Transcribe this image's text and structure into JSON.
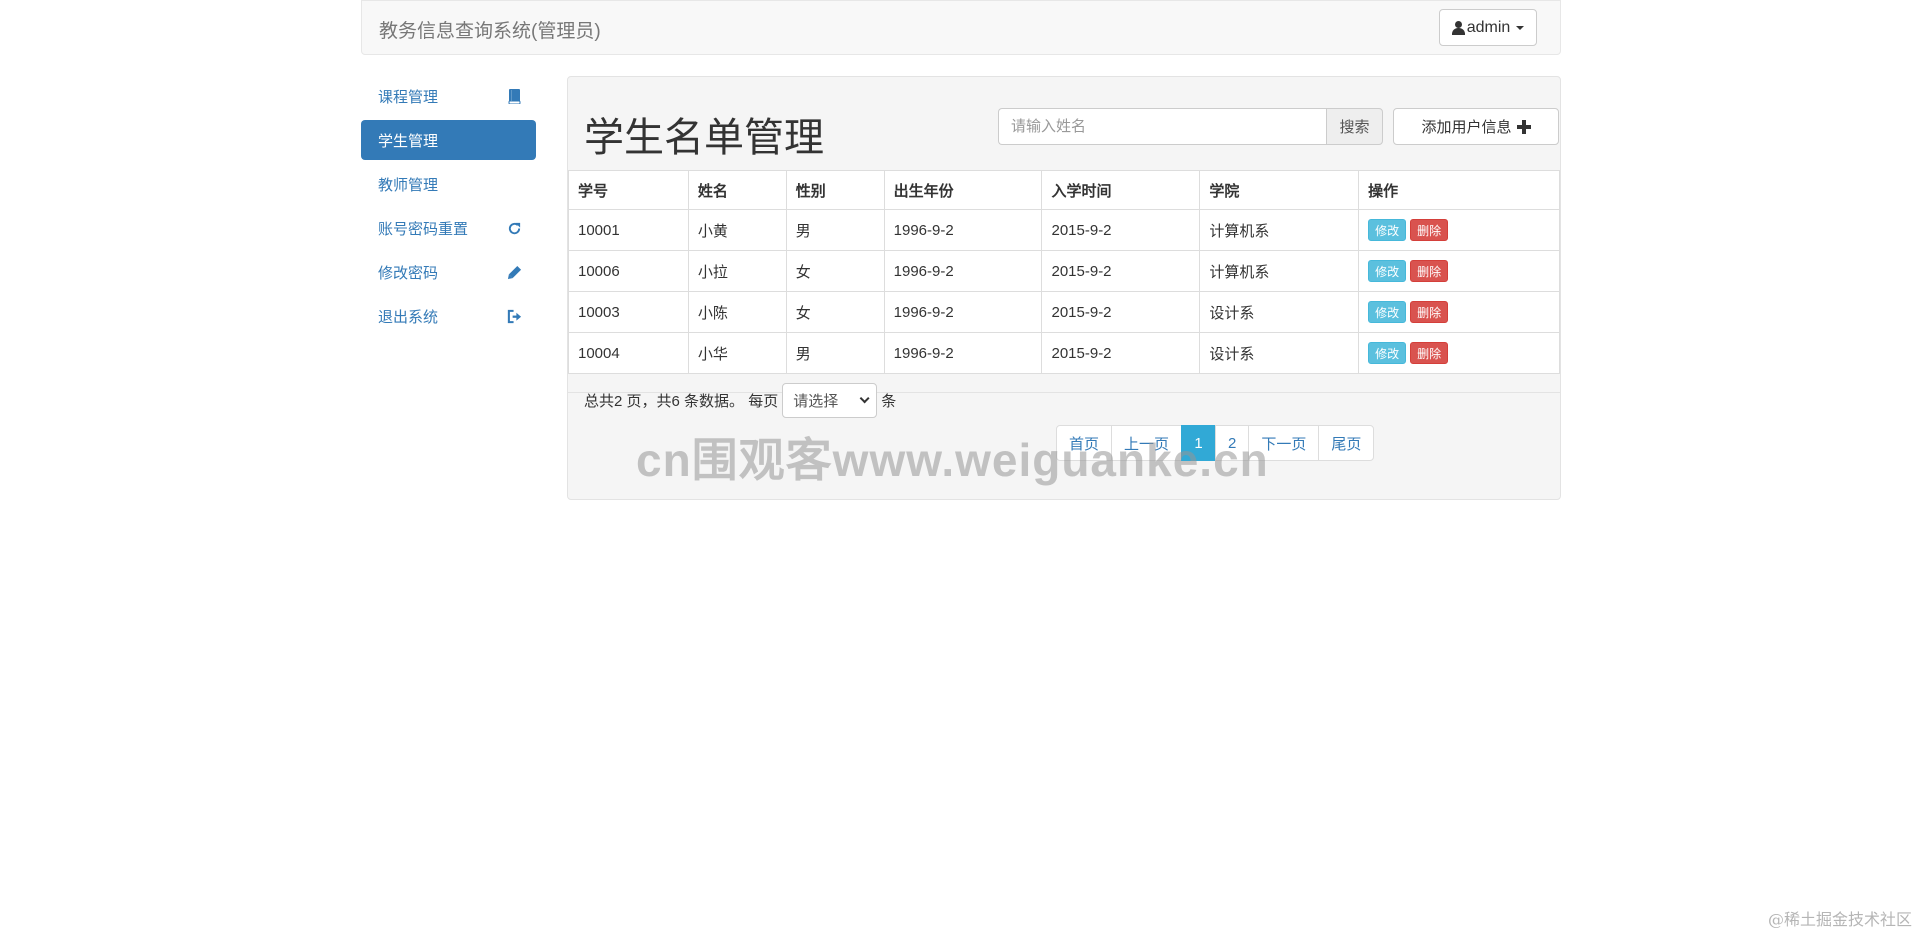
{
  "navbar": {
    "brand": "教务信息查询系统(管理员)",
    "user": "admin"
  },
  "sidebar": {
    "items": [
      {
        "label": "课程管理",
        "icon": "book-icon",
        "active": false
      },
      {
        "label": "学生管理",
        "icon": "",
        "active": true
      },
      {
        "label": "教师管理",
        "icon": "",
        "active": false
      },
      {
        "label": "账号密码重置",
        "icon": "refresh-icon",
        "active": false
      },
      {
        "label": "修改密码",
        "icon": "pencil-icon",
        "active": false
      },
      {
        "label": "退出系统",
        "icon": "logout-icon",
        "active": false
      }
    ]
  },
  "main": {
    "title": "学生名单管理",
    "search": {
      "placeholder": "请输入姓名",
      "value": "",
      "button": "搜索"
    },
    "add_button": "添加用户信息"
  },
  "table": {
    "headers": [
      "学号",
      "姓名",
      "性别",
      "出生年份",
      "入学时间",
      "学院",
      "操作"
    ],
    "rows": [
      {
        "id": "10001",
        "name": "小黄",
        "gender": "男",
        "birth": "1996-9-2",
        "enroll": "2015-9-2",
        "college": "计算机系"
      },
      {
        "id": "10006",
        "name": "小拉",
        "gender": "女",
        "birth": "1996-9-2",
        "enroll": "2015-9-2",
        "college": "计算机系"
      },
      {
        "id": "10003",
        "name": "小陈",
        "gender": "女",
        "birth": "1996-9-2",
        "enroll": "2015-9-2",
        "college": "设计系"
      },
      {
        "id": "10004",
        "name": "小华",
        "gender": "男",
        "birth": "1996-9-2",
        "enroll": "2015-9-2",
        "college": "设计系"
      }
    ],
    "edit_label": "修改",
    "delete_label": "删除"
  },
  "pager": {
    "summary": "总共2 页，共6 条数据。 每页",
    "select_value": "请选择",
    "unit": "条",
    "links": [
      "首页",
      "上一页",
      "1",
      "2",
      "下一页",
      "尾页"
    ],
    "current": "1"
  },
  "watermark": "cn围观客www.weiguanke.cn",
  "corner_mark": "@稀土掘金技术社区",
  "colors": {
    "primary": "#337ab7",
    "edit": "#5bc0de",
    "delete": "#d9534f",
    "current_page": "#31a9d6"
  }
}
